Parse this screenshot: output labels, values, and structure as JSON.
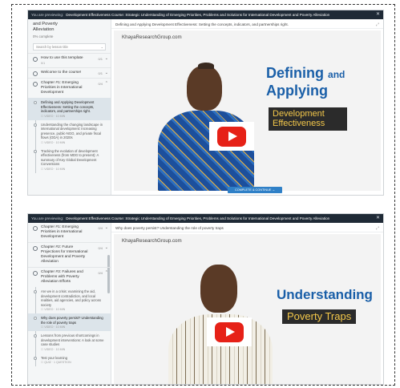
{
  "window": {
    "prefix": "You are previewing:",
    "course_title": "Development Effectiveness Course: Strategic Understanding of Emerging Priorities, Problems and Solutions for International Development and Poverty Alleviation",
    "close_glyph": "✕"
  },
  "screen1": {
    "sidebar": {
      "title_line1": "and Poverty",
      "title_line2": "Alleviation",
      "subtitle": "0% complete",
      "search_placeholder": "Search by lesson title",
      "items": [
        {
          "label": "How to use this template",
          "meta": "0/1",
          "count": "0/1"
        },
        {
          "label": "Welcome to the course!",
          "meta": "",
          "count": "0/1"
        },
        {
          "label": "Chapter #1: Emerging Priorities in International Development",
          "meta": "",
          "count": "0/4"
        }
      ],
      "lessons": [
        {
          "label": "Defining and Applying Development Effectiveness: Setting the concepts, indicators, and partnerships right.",
          "meta": "☐ VIDEO · 10 MIN"
        },
        {
          "label": "Understanding the changing landscape in international development: Increasing presence, public-NGO, and private fiscal flows (ODA) in 2020s",
          "meta": "☐ VIDEO · 10 MIN"
        },
        {
          "label": "Tracking the evolution of development effectiveness (from MDG to present): A summary of Key Global Development Conventions",
          "meta": "☐ VIDEO · 10 MIN"
        }
      ]
    },
    "main": {
      "lesson_title": "Defining and Applying Development Effectiveness: Setting the concepts, indicators, and partnerships right.",
      "site": "KhayaResearchGroup.com",
      "headline_line1": "Defining",
      "headline_and": "and",
      "headline_line2": "Applying",
      "box_line1": "Development",
      "box_line2": "Effectiveness",
      "complete_button": "COMPLETE & CONTINUE →"
    }
  },
  "screen2": {
    "sidebar": {
      "items": [
        {
          "label": "Chapter #1: Emerging Priorities in International Development",
          "count": "0/4"
        },
        {
          "label": "Chapter #2: Future Projections for International Development and Poverty Alleviation",
          "count": "0/4"
        },
        {
          "label": "Chapter #3: Failures and Problems with Poverty Alleviation Efforts",
          "count": "0/4"
        }
      ],
      "lessons": [
        {
          "label": "Are we in a crisis: examining the aid, development contradiction, and local realities, aid agencies, and policy across society",
          "meta": "☐ VIDEO · 10 MIN"
        },
        {
          "label": "Why does poverty persist? Understanding the role of poverty traps",
          "meta": "☐ VIDEO · 10 MIN"
        },
        {
          "label": "Lessons from previous shortcomings in development interventions: A look at some case studies",
          "meta": "☐ VIDEO · 10 MIN"
        },
        {
          "label": "Test your learning",
          "meta": "☐ QUIZ · 1 QUESTION"
        }
      ]
    },
    "main": {
      "lesson_title": "Why does poverty persist? Understanding the role of poverty traps",
      "site": "KhayaResearchGroup.com",
      "headline_blue": "Understanding",
      "box_line1": "Poverty Traps"
    }
  },
  "icons": {
    "expand": "⤢",
    "chevron_down": "⌄",
    "caret_up": "⌃",
    "play": "play-icon"
  },
  "colors": {
    "topbar": "#1f2a36",
    "headline_blue": "#1a5fa8",
    "box_bg": "#2b2b2b",
    "box_text": "#f4c84a",
    "youtube_red": "#e62117",
    "accent": "#2f80c7"
  }
}
